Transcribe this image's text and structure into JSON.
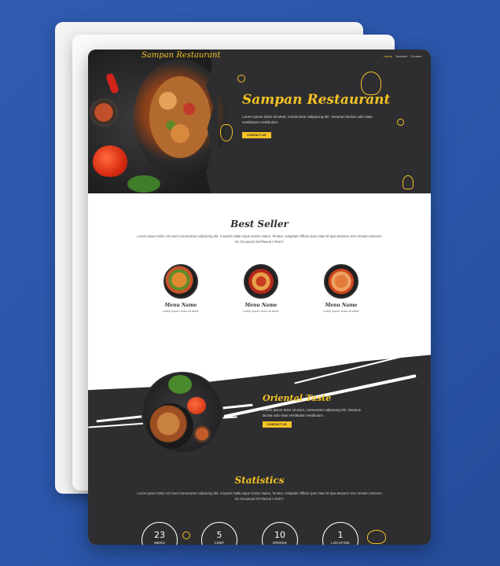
{
  "brand": {
    "logo": "Sampan Restaurant",
    "accent_color": "#f4c224",
    "dark_color": "#2e2e30"
  },
  "nav": {
    "items": [
      "Home",
      "Services",
      "Contact"
    ],
    "active": "Home"
  },
  "hero": {
    "title": "Sampan Restaurant",
    "text": "Lorem ipsum dolor sit amet, consectetur adipiscing elit. Vivamus lacinia odio vitae vestibulum vestibulum.",
    "button": "CONTACT US"
  },
  "best_seller": {
    "title": "Best Seller",
    "text": "Lorem Ipsum Dolor Sit Amet Consectetur Adipiscing Elit. Corporis Nulla Atque Dolore Natus, Tenetur, Voluptate Officiis Quis Vitae Et Ipsa Maiores Vero Veniam Dolorem Ex Occaecati Sit Placeat A Rem?",
    "items": [
      {
        "name": "Menu Name",
        "desc": "Lorem ipsum dolor sit amet."
      },
      {
        "name": "Menu Name",
        "desc": "Lorem ipsum dolor sit amet."
      },
      {
        "name": "Menu Name",
        "desc": "Lorem ipsum dolor sit amet."
      }
    ]
  },
  "oriental": {
    "title": "Oriental Taste",
    "text": "Lorem ipsum dolor sit amet, consectetur adipiscing elit. Vivamus lacinia odio vitae vestibulum vestibulum.",
    "button": "CONTACT US"
  },
  "statistics": {
    "title": "Statistics",
    "text": "Lorem Ipsum Dolor Sit Amet Consectetur Adipiscing Elit. Corporis Nulla Atque Dolore Natus, Tenetur, Voluptate Officiis Quis Vitae Et Ipsa Maiores Vero Veniam Dolorem Ex Occaecati Sit Placeat A Rem?",
    "items": [
      {
        "value": "23",
        "label": "MENU"
      },
      {
        "value": "5",
        "label": "CHEF"
      },
      {
        "value": "10",
        "label": "DRINKS"
      },
      {
        "value": "1",
        "label": "LOCATION"
      }
    ]
  }
}
